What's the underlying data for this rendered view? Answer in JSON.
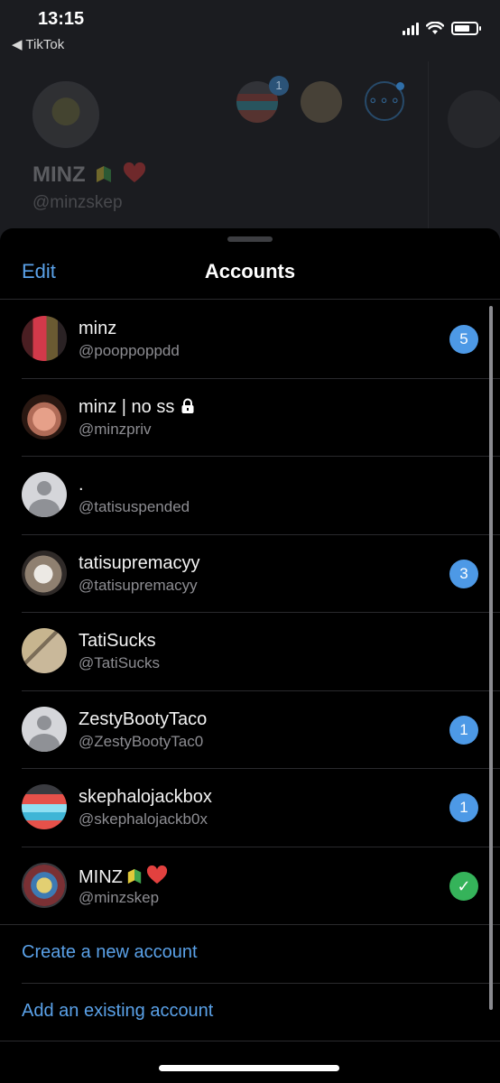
{
  "status_bar": {
    "time": "13:15",
    "back_app": "◀ TikTok"
  },
  "background_profile": {
    "display_name": "MINZ",
    "username": "@minzskep",
    "account_badge_count": "1",
    "more_label": "∘∘∘"
  },
  "sheet": {
    "edit_label": "Edit",
    "title": "Accounts"
  },
  "accounts": [
    {
      "name": "minz",
      "handle": "@pooppoppdd",
      "badge": "5",
      "avatar": "av-minz"
    },
    {
      "name": "minz | no ss",
      "handle": "@minzpriv",
      "badge": "",
      "avatar": "av-minzpriv",
      "icon": "lock-icon"
    },
    {
      "name": ".",
      "handle": "@tatisuspended",
      "badge": "",
      "avatar": "av-default"
    },
    {
      "name": "tatisupremacyy",
      "handle": "@tatisupremacyy",
      "badge": "3",
      "avatar": "av-supremacy"
    },
    {
      "name": "TatiSucks",
      "handle": "@TatiSucks",
      "badge": "",
      "avatar": "av-tatisucks"
    },
    {
      "name": "ZestyBootyTaco",
      "handle": "@ZestyBootyTac0",
      "badge": "1",
      "avatar": "av-default"
    },
    {
      "name": "skephalojackbox",
      "handle": "@skephalojackb0x",
      "badge": "1",
      "avatar": "av-skep"
    },
    {
      "name": "MINZ",
      "handle": "@minzskep",
      "badge": "✓",
      "avatar": "av-main",
      "icon": "beginner-heart",
      "selected": true
    }
  ],
  "actions": {
    "create": "Create a new account",
    "add_existing": "Add an existing account"
  },
  "colors": {
    "accent": "#5aa1e8",
    "badge": "#4d99e6",
    "selected": "#35b35a",
    "sheet_bg": "#000000"
  }
}
